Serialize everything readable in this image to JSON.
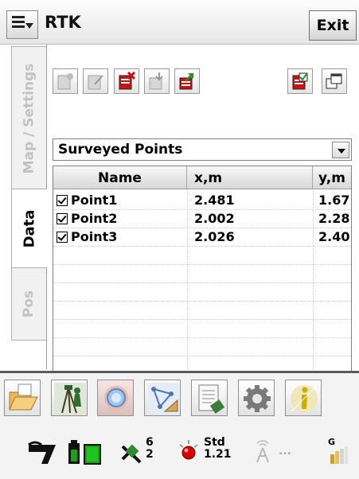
{
  "window": {
    "title": "RTK",
    "exit_label": "Exit"
  },
  "tabs": [
    {
      "label": "Map / Settings",
      "active": false
    },
    {
      "label": "Data",
      "active": true
    },
    {
      "label": "Pos",
      "active": false
    }
  ],
  "toolbar": {
    "icons": [
      "new-point-icon",
      "edit-point-icon",
      "delete-point-icon",
      "import-icon",
      "export-icon",
      "select-all-icon",
      "copy-icon"
    ]
  },
  "layer_select": {
    "value": "Surveyed Points"
  },
  "table": {
    "columns": [
      "Name",
      "x,m",
      "y,m"
    ],
    "rows": [
      {
        "checked": true,
        "name": "Point1",
        "x": "2.481",
        "y": "1.67"
      },
      {
        "checked": true,
        "name": "Point2",
        "x": "2.002",
        "y": "2.28"
      },
      {
        "checked": true,
        "name": "Point3",
        "x": "2.026",
        "y": "2.40"
      }
    ]
  },
  "appbar": {
    "buttons": [
      "open-folder-icon",
      "surveyor-icon",
      "lookup-icon",
      "geometry-icon",
      "notes-icon",
      "settings-gear-icon",
      "info-icon"
    ]
  },
  "status": {
    "satellites_top": "6",
    "satellites_bottom": "2",
    "solution_label": "Std",
    "solution_value": "1.21",
    "radio_text": "...",
    "gps_label": "G",
    "colors": {
      "battery": "#16a316",
      "fix_dot": "#d40000",
      "accent_red": "#cc1111",
      "accent_green": "#2e8b2e"
    }
  }
}
